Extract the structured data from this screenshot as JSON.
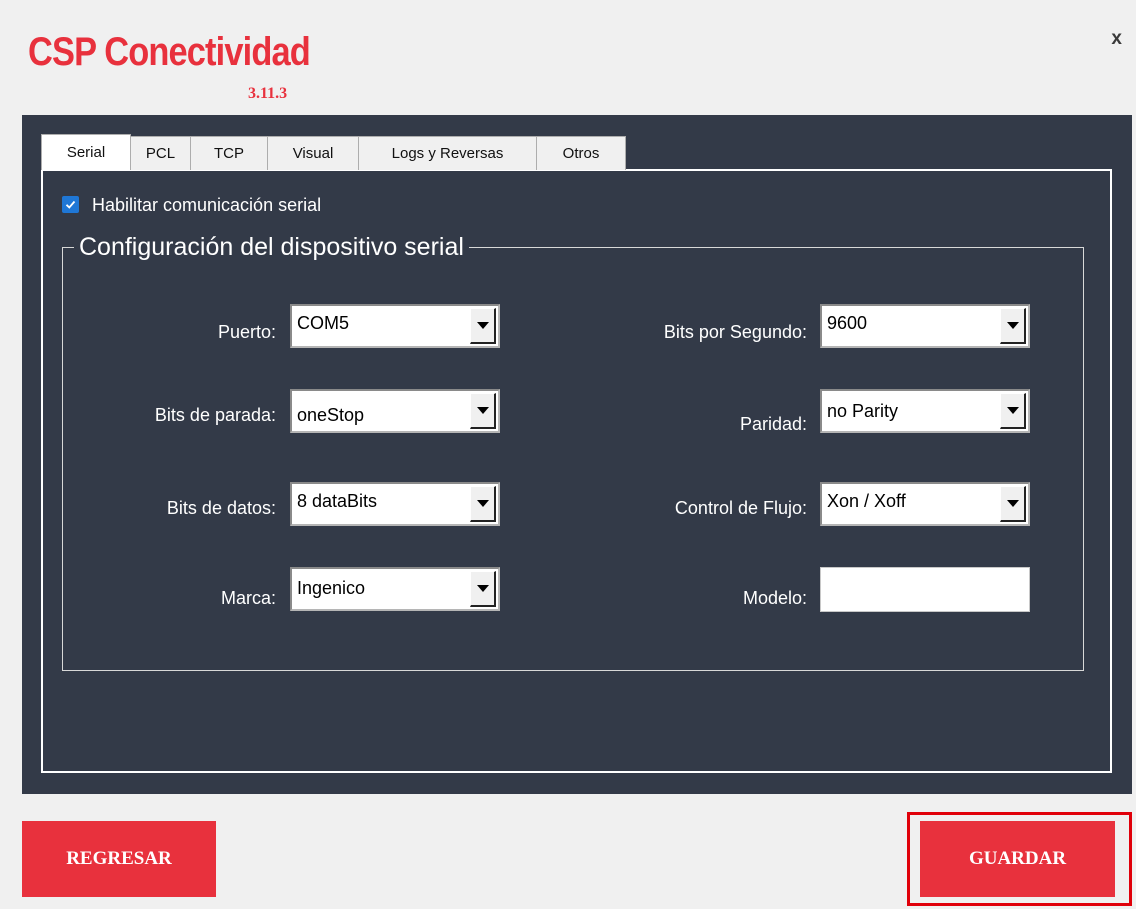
{
  "app": {
    "title": "CSP Conectividad",
    "version": "3.11.3",
    "close_label": "x"
  },
  "tabs": [
    {
      "label": "Serial",
      "active": true
    },
    {
      "label": "PCL"
    },
    {
      "label": "TCP"
    },
    {
      "label": "Visual"
    },
    {
      "label": "Logs y Reversas"
    },
    {
      "label": "Otros"
    }
  ],
  "serial": {
    "enable_label": "Habilitar comunicación serial",
    "enable_checked": true,
    "group_title": "Configuración del dispositivo serial",
    "fields": {
      "puerto": {
        "label": "Puerto:",
        "value": "COM5"
      },
      "bits_por_segundo": {
        "label": "Bits por Segundo:",
        "value": "9600"
      },
      "bits_de_parada": {
        "label": "Bits de parada:",
        "value": "oneStop"
      },
      "paridad": {
        "label": "Paridad:",
        "value": "no Parity"
      },
      "bits_de_datos": {
        "label": "Bits de datos:",
        "value": "8 dataBits"
      },
      "control_de_flujo": {
        "label": "Control de Flujo:",
        "value": "Xon / Xoff"
      },
      "marca": {
        "label": "Marca:",
        "value": "Ingenico"
      },
      "modelo": {
        "label": "Modelo:",
        "value": ""
      }
    }
  },
  "buttons": {
    "back": "REGRESAR",
    "save": "GUARDAR"
  },
  "colors": {
    "accent": "#e8313d",
    "panel": "#333a48",
    "checkbox": "#1f77d6"
  }
}
